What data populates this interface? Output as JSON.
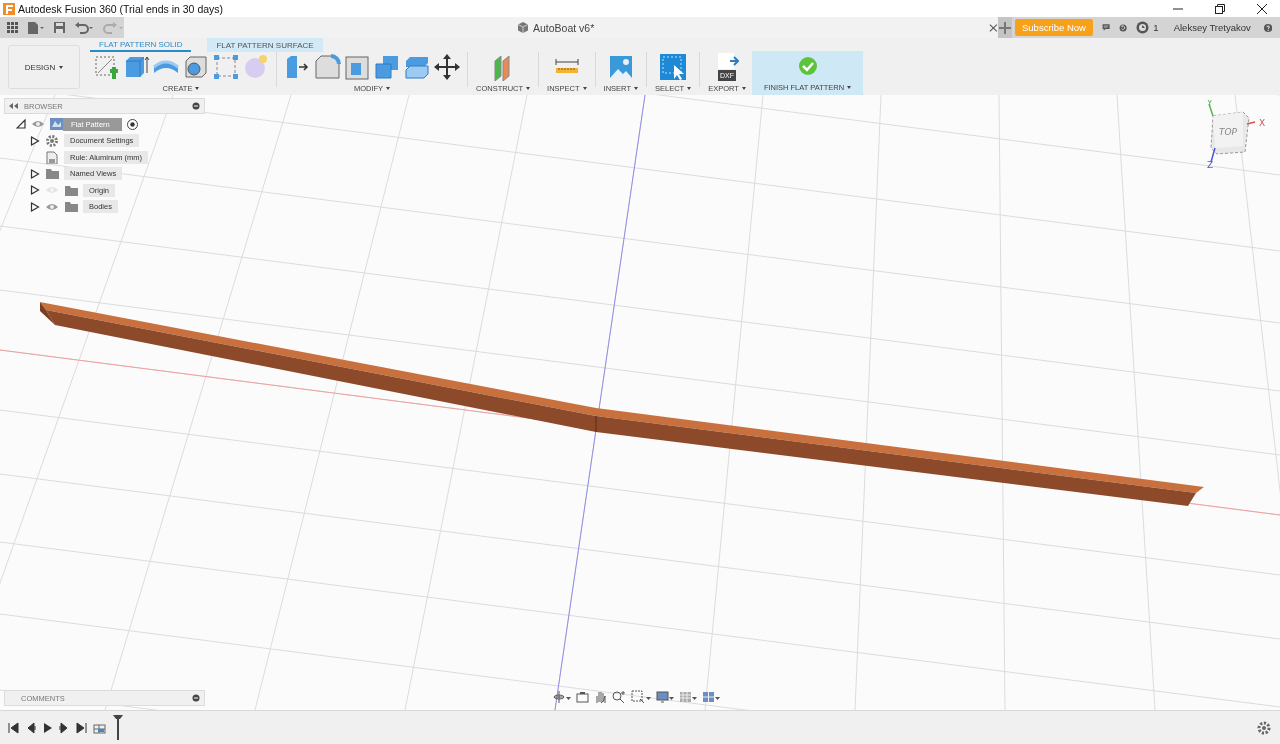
{
  "window": {
    "title": "Autodesk Fusion 360 (Trial ends in 30 days)"
  },
  "document_tab": {
    "title": "AutoBoat v6*"
  },
  "account": {
    "subscribe": "Subscribe Now",
    "jobs_count": "1",
    "user": "Aleksey Tretyakov"
  },
  "workspace": {
    "label": "DESIGN"
  },
  "ribbon_tabs": [
    {
      "label": "FLAT PATTERN SOLID",
      "selected": true
    },
    {
      "label": "FLAT PATTERN SURFACE",
      "selected": false
    }
  ],
  "ribbon_groups": [
    {
      "kind": "create",
      "label": "CREATE"
    },
    {
      "kind": "modify",
      "label": "MODIFY"
    },
    {
      "kind": "construct",
      "label": "CONSTRUCT"
    },
    {
      "kind": "inspect",
      "label": "INSPECT"
    },
    {
      "kind": "insert",
      "label": "INSERT"
    },
    {
      "kind": "select",
      "label": "SELECT"
    },
    {
      "kind": "export",
      "label": "EXPORT",
      "icon_text": "DXF"
    },
    {
      "kind": "finish",
      "label": "FINISH FLAT PATTERN"
    }
  ],
  "browser": {
    "title": "BROWSER",
    "items": [
      {
        "label": "Flat Pattern",
        "kind": "component",
        "selected": true,
        "expanded": true,
        "visible": true,
        "active": true,
        "children": [
          {
            "label": "Document Settings",
            "kind": "settings",
            "selected": false,
            "expanded": false
          },
          {
            "label": "Rule: Aluminum (mm)",
            "kind": "rule",
            "selected": false
          },
          {
            "label": "Named Views",
            "kind": "folder",
            "selected": false,
            "expanded": false
          },
          {
            "label": "Origin",
            "kind": "folder",
            "selected": false,
            "expanded": false,
            "visible": false
          },
          {
            "label": "Bodies",
            "kind": "folder",
            "selected": false,
            "expanded": false,
            "visible": true
          }
        ]
      }
    ]
  },
  "view_cube": {
    "face": "TOP",
    "axes": [
      {
        "label": "X",
        "color": "#e0504a"
      },
      {
        "label": "Y",
        "color": "#4cb84c"
      },
      {
        "label": "Z",
        "color": "#4a5ad8"
      }
    ]
  },
  "comments": {
    "title": "COMMENTS"
  }
}
